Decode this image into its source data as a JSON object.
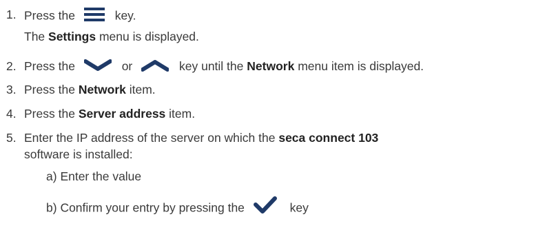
{
  "steps": [
    {
      "number": "1.",
      "before": "Press the",
      "icon": "menu-icon",
      "after": "key.",
      "result_pre": "The",
      "result_bold": "Settings",
      "result_post": "menu is displayed."
    },
    {
      "number": "2.",
      "before": "Press the",
      "icon1": "chevron-down-icon",
      "or": "or",
      "icon2": "chevron-up-icon",
      "mid": "key until the",
      "bold": "Network",
      "after": "menu item is displayed."
    },
    {
      "number": "3.",
      "before": "Press the",
      "bold": "Network",
      "after": "item."
    },
    {
      "number": "4.",
      "before": "Press the",
      "bold": "Server address",
      "after": "item."
    },
    {
      "number": "5.",
      "before": "Enter the IP address of the server on which the",
      "bold": "seca connect 103",
      "line2": "software is installed:",
      "substeps": [
        {
          "label": "a)",
          "text": "Enter the value"
        },
        {
          "label": "b)",
          "before": "Confirm your entry by pressing the",
          "icon": "checkmark-icon",
          "after": "key"
        }
      ]
    }
  ],
  "colors": {
    "text": "#3a3a3a",
    "bold": "#222222",
    "icon": "#1f3a68"
  }
}
